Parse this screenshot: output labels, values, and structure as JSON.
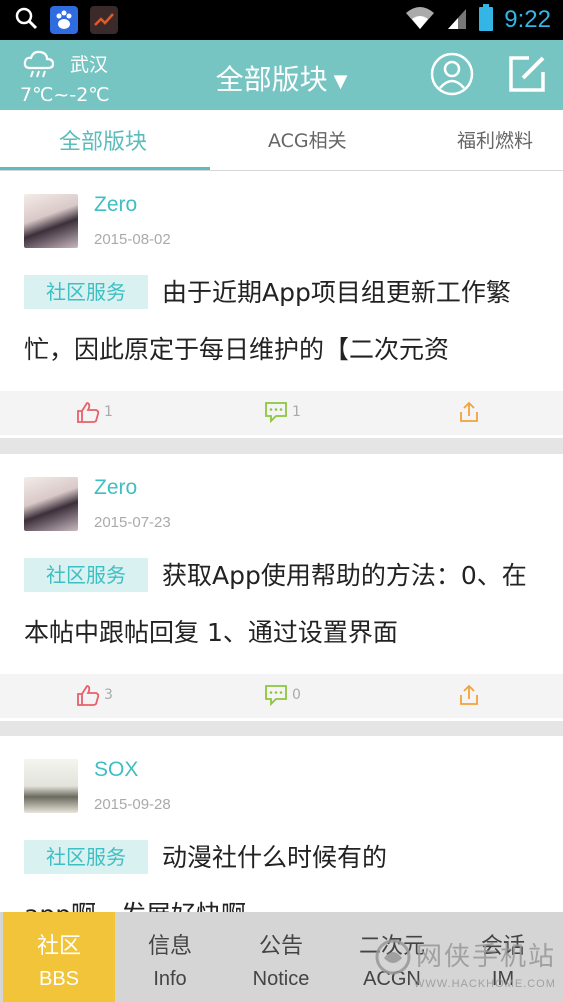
{
  "status_bar": {
    "time": "9:22",
    "left_icons": [
      "search-icon",
      "baidu-app-icon",
      "chart-app-icon"
    ],
    "right_icons": [
      "wifi-icon",
      "signal-icon",
      "battery-icon"
    ]
  },
  "header": {
    "city": "武汉",
    "temperature": "7℃~-2℃",
    "weather_icon": "cloud-rain-icon",
    "title": "全部版块",
    "caret": "▼"
  },
  "tabs": [
    {
      "label": "全部版块",
      "active": true
    },
    {
      "label": "ACG相关",
      "active": false
    },
    {
      "label": "福利燃料",
      "active": false
    }
  ],
  "posts": [
    {
      "author": "Zero",
      "date": "2015-08-02",
      "tag": "社区服务",
      "excerpt": "由于近期App项目组更新工作繁忙，因此原定于每日维护的【二次元资",
      "likes": "1",
      "comments": "1"
    },
    {
      "author": "Zero",
      "date": "2015-07-23",
      "tag": "社区服务",
      "excerpt": "获取App使用帮助的方法：0、在本帖中跟帖回复 1、通过设置界面",
      "likes": "3",
      "comments": "0"
    },
    {
      "author": "SOX",
      "date": "2015-09-28",
      "tag": "社区服务",
      "excerpt": "动漫社什么时候有的app啊，发展好快啊"
    }
  ],
  "bottom_nav": [
    {
      "zh": "社区",
      "en": "BBS",
      "active": true
    },
    {
      "zh": "信息",
      "en": "Info",
      "active": false
    },
    {
      "zh": "公告",
      "en": "Notice",
      "active": false
    },
    {
      "zh": "二次元",
      "en": "ACGN",
      "active": false
    },
    {
      "zh": "会话",
      "en": "IM",
      "active": false
    }
  ],
  "watermark": {
    "text": "网侠手机站",
    "url": "WWW.HACKHOME.COM"
  },
  "colors": {
    "header": "#77c5c3",
    "accent": "#3fbfc3",
    "tag_bg": "#d9f1f1",
    "nav_active": "#f2c43a",
    "like": "#e8606a",
    "comment": "#8cc63f",
    "share": "#f2a33a"
  }
}
